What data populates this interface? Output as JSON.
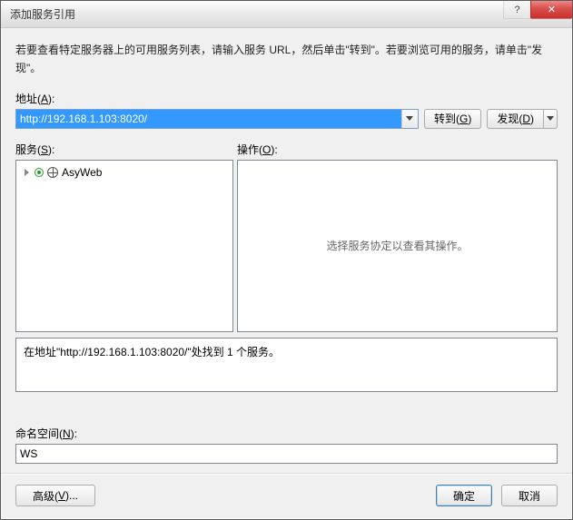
{
  "title": "添加服务引用",
  "instruction": "若要查看特定服务器上的可用服务列表，请输入服务 URL，然后单击\"转到\"。若要浏览可用的服务，请单击\"发现\"。",
  "labels": {
    "address_prefix": "地址(",
    "address_key": "A",
    "address_suffix": "):",
    "services_prefix": "服务(",
    "services_key": "S",
    "services_suffix": "):",
    "operations_prefix": "操作(",
    "operations_key": "O",
    "operations_suffix": "):",
    "namespace_prefix": "命名空间(",
    "namespace_key": "N",
    "namespace_suffix": "):"
  },
  "address": {
    "value": "http://192.168.1.103:8020/"
  },
  "buttons": {
    "go_prefix": "转到(",
    "go_key": "G",
    "go_suffix": ")",
    "discover_prefix": "发现(",
    "discover_key": "D",
    "discover_suffix": ")",
    "advanced_prefix": "高级(",
    "advanced_key": "V",
    "advanced_suffix": ")...",
    "ok": "确定",
    "cancel": "取消"
  },
  "services": {
    "items": [
      {
        "label": "AsyWeb"
      }
    ]
  },
  "operations": {
    "empty": "选择服务协定以查看其操作。"
  },
  "status": "在地址\"http://192.168.1.103:8020/\"处找到 1 个服务。",
  "namespace": {
    "value": "WS"
  }
}
